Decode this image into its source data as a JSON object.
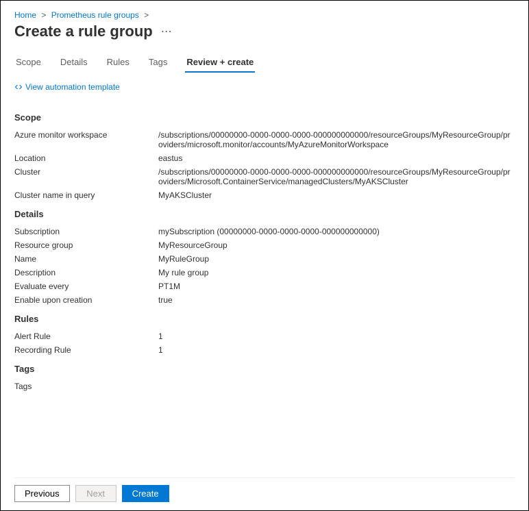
{
  "breadcrumb": {
    "home": "Home",
    "parent": "Prometheus rule groups"
  },
  "title": "Create a rule group",
  "tabs": {
    "scope": "Scope",
    "details": "Details",
    "rules": "Rules",
    "tags": "Tags",
    "review": "Review + create"
  },
  "view_template_link": "View automation template",
  "sections": {
    "scope": {
      "heading": "Scope",
      "azure_monitor_ws_label": "Azure monitor workspace",
      "azure_monitor_ws_value": "/subscriptions/00000000-0000-0000-0000-000000000000/resourceGroups/MyResourceGroup/providers/microsoft.monitor/accounts/MyAzureMonitorWorkspace",
      "location_label": "Location",
      "location_value": "eastus",
      "cluster_label": "Cluster",
      "cluster_value": "/subscriptions/00000000-0000-0000-0000-000000000000/resourceGroups/MyResourceGroup/providers/Microsoft.ContainerService/managedClusters/MyAKSCluster",
      "cluster_name_label": "Cluster name in query",
      "cluster_name_value": "MyAKSCluster"
    },
    "details": {
      "heading": "Details",
      "subscription_label": "Subscription",
      "subscription_value": "mySubscription (00000000-0000-0000-0000-000000000000)",
      "rg_label": "Resource group",
      "rg_value": "MyResourceGroup",
      "name_label": "Name",
      "name_value": "MyRuleGroup",
      "description_label": "Description",
      "description_value": "My rule group",
      "eval_label": "Evaluate every",
      "eval_value": "PT1M",
      "enable_label": "Enable upon creation",
      "enable_value": "true"
    },
    "rules": {
      "heading": "Rules",
      "alert_label": "Alert Rule",
      "alert_value": "1",
      "recording_label": "Recording Rule",
      "recording_value": "1"
    },
    "tags": {
      "heading": "Tags",
      "tags_label": "Tags",
      "tags_value": ""
    }
  },
  "footer": {
    "previous": "Previous",
    "next": "Next",
    "create": "Create"
  }
}
